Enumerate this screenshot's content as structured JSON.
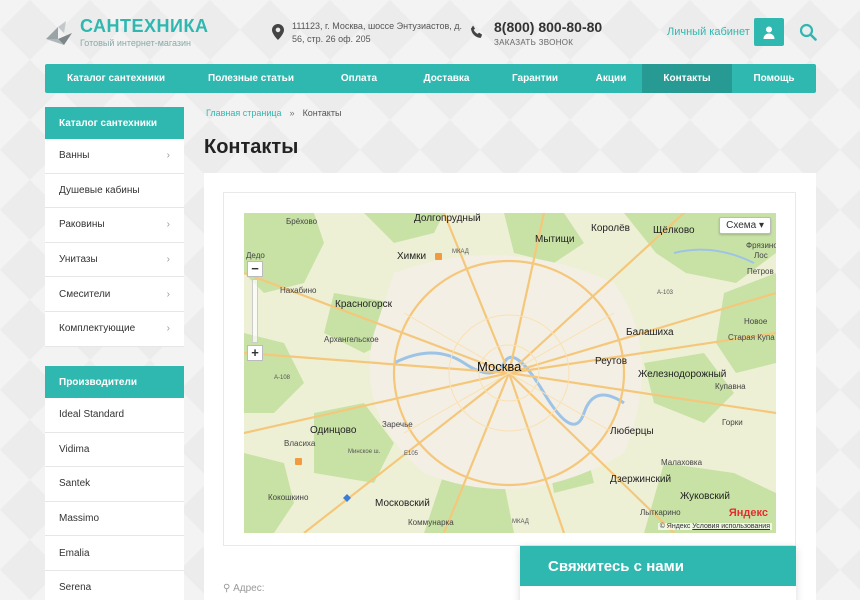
{
  "header": {
    "logo_title": "САНТЕХНИКА",
    "logo_subtitle": "Готовый интернет-магазин",
    "address": "111123, г. Москва, шоссе Энтузиастов, д. 56, стр. 26 оф. 205",
    "phone": "8(800) 800-80-80",
    "call_back": "ЗАКАЗАТЬ ЗВОНОК",
    "account_label": "Личный кабинет",
    "icons": [
      "location-pin-icon",
      "phone-icon",
      "user-icon",
      "search-icon"
    ]
  },
  "nav": {
    "items": [
      {
        "label": "Каталог сантехники"
      },
      {
        "label": "Полезные статьи"
      },
      {
        "label": "Оплата"
      },
      {
        "label": "Доставка"
      },
      {
        "label": "Гарантии"
      },
      {
        "label": "Акции"
      },
      {
        "label": "Контакты",
        "active": true
      },
      {
        "label": "Помощь"
      }
    ]
  },
  "sidebar": {
    "catalog_title": "Каталог сантехники",
    "catalog_items": [
      {
        "label": "Ванны",
        "has_children": true
      },
      {
        "label": "Душевые кабины",
        "has_children": false
      },
      {
        "label": "Раковины",
        "has_children": true
      },
      {
        "label": "Унитазы",
        "has_children": true
      },
      {
        "label": "Смесители",
        "has_children": true
      },
      {
        "label": "Комплектующие",
        "has_children": true
      }
    ],
    "brands_title": "Производители",
    "brands": [
      "Ideal Standard",
      "Vidima",
      "Santek",
      "Massimo",
      "Emalia",
      "Serena"
    ]
  },
  "breadcrumb": {
    "home": "Главная страница",
    "separator": "»",
    "current": "Контакты"
  },
  "page": {
    "title": "Контакты"
  },
  "map": {
    "type_selector": "Схема ▾",
    "zoom_in": "+",
    "zoom_out": "−",
    "logo": "Яндекс",
    "copyright": "© Яндекс",
    "terms": "Условия использования",
    "labels": {
      "moscow": "Москва",
      "dolgoprudny": "Долгопрудный",
      "mytishchi": "Мытищи",
      "korolyov": "Королёв",
      "shchyolkovo": "Щёлково",
      "khimki": "Химки",
      "krasnogorsk": "Красногорск",
      "nakhabino": "Нахабино",
      "arkhangelskoye": "Архангельское",
      "balashikha": "Балашиха",
      "reutov": "Реутов",
      "zheleznodorozhny": "Железнодорожный",
      "odintsovo": "Одинцово",
      "zarechye": "Заречье",
      "vlasikha": "Власиха",
      "lyubertsy": "Люберцы",
      "dzerzhinsky": "Дзержинский",
      "zhukovsky": "Жуковский",
      "lytkarino": "Лыткарино",
      "kokoshkino": "Кокошкино",
      "moskovsky": "Московский",
      "kommunarka": "Коммунарка",
      "malakhovka": "Малаховка",
      "kupavna": "Купавна",
      "staraya_kupavna": "Старая Купа",
      "petrovskoye": "Петров",
      "losino": "Лос",
      "brekhovo": "Брёхово",
      "dedovsk": "Дедо",
      "gorki": "Горки",
      "novoe": "Новое",
      "fryazino": "Фрязино",
      "mkad": "МКАД",
      "a103": "А-103",
      "a108": "А-108",
      "e105": "Е105",
      "minskoe": "Минское ш."
    }
  },
  "contact": {
    "address_label": "Адрес:",
    "cta_title": "Свяжитесь с нами"
  },
  "colors": {
    "accent": "#2fb8b0",
    "accent_dark": "#279a93"
  }
}
